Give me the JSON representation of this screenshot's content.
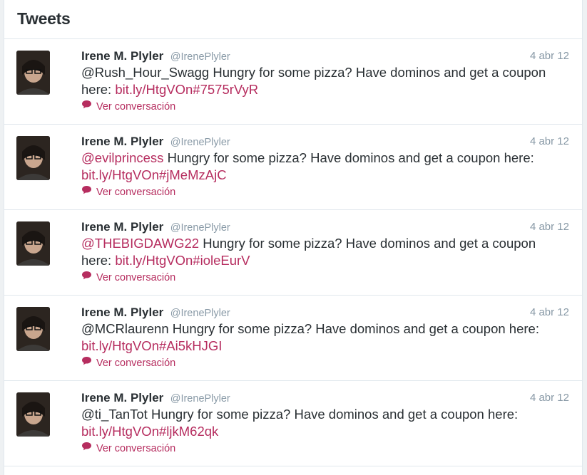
{
  "header": {
    "title": "Tweets"
  },
  "colors": {
    "link": "#b62d5f",
    "muted": "#8899a6",
    "text": "#292f33"
  },
  "icons": {
    "conversation": "speech-bubble-icon"
  },
  "tweets": [
    {
      "fullname": "Irene M. Plyler",
      "username": "@IrenePlyler",
      "time": "4 abr 12",
      "mention": "@Rush_Hour_Swagg",
      "body": " Hungry for some pizza? Have dominos and get a coupon here: ",
      "link": "bit.ly/HtgVOn#7575rVyR",
      "convo": "Ver conversación"
    },
    {
      "fullname": "Irene M. Plyler",
      "username": "@IrenePlyler",
      "time": "4 abr 12",
      "mention": "@evilprincess",
      "body": " Hungry for some pizza? Have dominos and get a coupon here: ",
      "link": "bit.ly/HtgVOn#jMeMzAjC",
      "convo": "Ver conversación"
    },
    {
      "fullname": "Irene M. Plyler",
      "username": "@IrenePlyler",
      "time": "4 abr 12",
      "mention": "@THEBIGDAWG22",
      "body": " Hungry for some pizza? Have dominos and get a coupon here: ",
      "link": "bit.ly/HtgVOn#ioleEurV",
      "convo": "Ver conversación"
    },
    {
      "fullname": "Irene M. Plyler",
      "username": "@IrenePlyler",
      "time": "4 abr 12",
      "mention": "@MCRlaurenn",
      "body": " Hungry for some pizza? Have dominos and get a coupon here: ",
      "link": "bit.ly/HtgVOn#Ai5kHJGI",
      "convo": "Ver conversación"
    },
    {
      "fullname": "Irene M. Plyler",
      "username": "@IrenePlyler",
      "time": "4 abr 12",
      "mention": "@ti_TanTot",
      "body": " Hungry for some pizza? Have dominos and get a coupon here: ",
      "link": "bit.ly/HtgVOn#ljkM62qk",
      "convo": "Ver conversación"
    }
  ]
}
